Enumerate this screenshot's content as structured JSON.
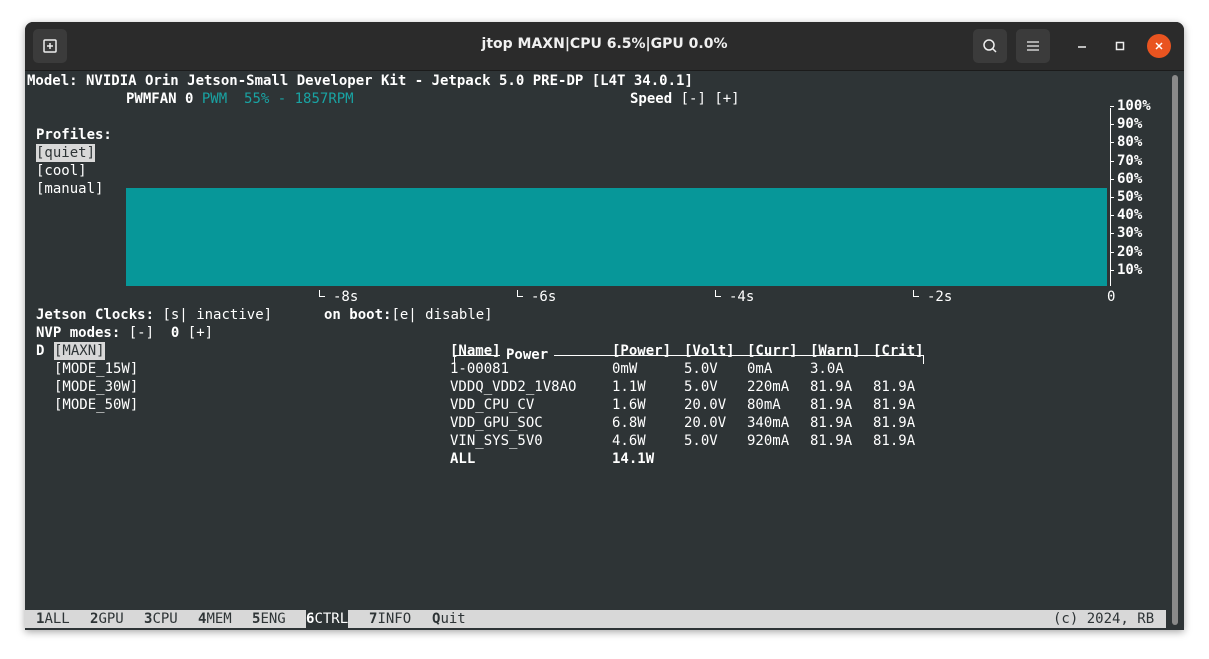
{
  "window": {
    "title": "jtop MAXN|CPU 6.5%|GPU 0.0%"
  },
  "header": {
    "model": "Model: NVIDIA Orin Jetson-Small Developer Kit - Jetpack 5.0 PRE-DP [L4T 34.0.1]",
    "fan_label": "PWMFAN 0",
    "fan_mode": "PWM",
    "fan_value": "55% - 1857RPM",
    "speed_label": "Speed",
    "speed_minus": "[-]",
    "speed_plus": "[+]"
  },
  "profiles": {
    "title": "Profiles:",
    "items": [
      "[quiet]",
      "[cool]",
      "[manual]"
    ],
    "selected": "[quiet]"
  },
  "fan_chart": {
    "y_labels": [
      "100%",
      "90%",
      "80%",
      "70%",
      "60%",
      "50%",
      "40%",
      "30%",
      "20%",
      "10%"
    ],
    "x_labels": [
      "-8s",
      "-6s",
      "-4s",
      "-2s",
      "0"
    ]
  },
  "chart_data": {
    "type": "area",
    "title": "",
    "xlabel": "",
    "ylabel": "",
    "x": [
      -10,
      0
    ],
    "values": [
      55,
      55
    ],
    "xlim": [
      -10,
      0
    ],
    "ylim": [
      0,
      100
    ],
    "y_ticks": [
      "100%",
      "90%",
      "80%",
      "70%",
      "60%",
      "50%",
      "40%",
      "30%",
      "20%",
      "10%"
    ],
    "x_ticks": [
      "-8s",
      "-6s",
      "-4s",
      "-2s",
      "0"
    ],
    "color": "#079799"
  },
  "clocks": {
    "label": "Jetson Clocks:",
    "toggle": "[s|",
    "state": "inactive]",
    "boot_label": "on boot:",
    "boot_toggle": "[e|",
    "boot_state": "disable]"
  },
  "nvp": {
    "label": "NVP modes:",
    "minus": "[-]",
    "current": "0",
    "plus": "[+]",
    "default_marker": "D",
    "modes": [
      "[MAXN]",
      "[MODE_15W]",
      "[MODE_30W]",
      "[MODE_50W]"
    ]
  },
  "power": {
    "title": "Power",
    "headers": [
      "[Name]",
      "[Power]",
      "[Volt]",
      "[Curr]",
      "[Warn]",
      "[Crit]"
    ],
    "rows": [
      [
        "1-00081",
        "0mW",
        "5.0V",
        "0mA",
        "3.0A",
        ""
      ],
      [
        "VDDQ_VDD2_1V8AO",
        "1.1W",
        "5.0V",
        "220mA",
        "81.9A",
        "81.9A"
      ],
      [
        "VDD_CPU_CV",
        "1.6W",
        "20.0V",
        "80mA",
        "81.9A",
        "81.9A"
      ],
      [
        "VDD_GPU_SOC",
        "6.8W",
        "20.0V",
        "340mA",
        "81.9A",
        "81.9A"
      ],
      [
        "VIN_SYS_5V0",
        "4.6W",
        "5.0V",
        "920mA",
        "81.9A",
        "81.9A"
      ]
    ],
    "total": [
      "ALL",
      "14.1W"
    ]
  },
  "bottom": {
    "tabs": [
      {
        "num": "1",
        "label": "ALL"
      },
      {
        "num": "2",
        "label": "GPU"
      },
      {
        "num": "3",
        "label": "CPU"
      },
      {
        "num": "4",
        "label": "MEM"
      },
      {
        "num": "5",
        "label": "ENG"
      },
      {
        "num": "6",
        "label": "CTRL"
      },
      {
        "num": "7",
        "label": "INFO"
      },
      {
        "num": "Q",
        "label": "uit"
      }
    ],
    "copyright": "(c) 2024, RB"
  }
}
